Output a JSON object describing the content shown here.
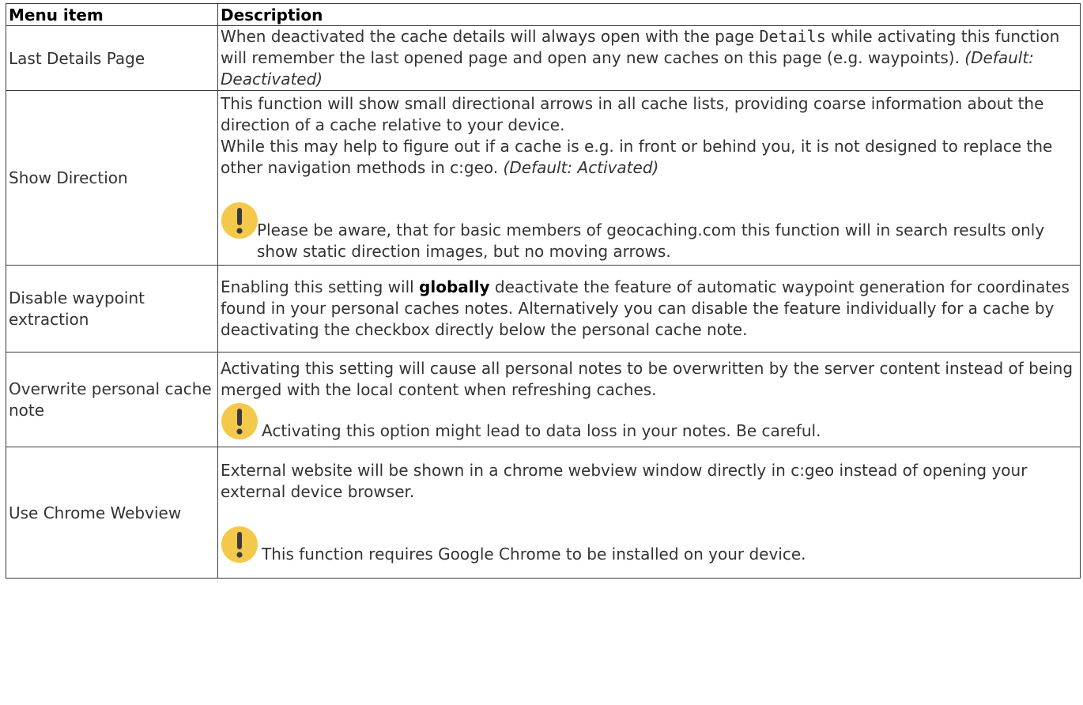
{
  "table": {
    "headers": {
      "item": "Menu item",
      "description": "Description"
    },
    "rows": [
      {
        "item": "Last Details Page",
        "text_before": "When deactivated the cache details will always open with the page ",
        "code": "Details",
        "text_after": " while activating this function will remember the last opened page and open any new caches on this page (e.g. waypoints). ",
        "default": "(Default: Deactivated)"
      },
      {
        "item": "Show Direction",
        "para1": "This function will show small directional arrows in all cache lists, providing coarse information about the direction of a cache relative to your device.",
        "para2": "While this may help to figure out if a cache is e.g. in front or behind you, it is not designed to replace the other navigation methods in c:geo. ",
        "default": "(Default: Activated)",
        "note": "Please be aware, that for basic members of geocaching.com this function will in search results only show static direction images, but no moving arrows."
      },
      {
        "item": "Disable waypoint extraction",
        "text_before": "Enabling this setting will ",
        "bold": "globally",
        "text_after": " deactivate the feature of automatic waypoint generation for coordinates found in your personal caches notes. Alternatively you can disable the feature individually for a cache by deactivating the checkbox directly below the personal cache note."
      },
      {
        "item": "Overwrite personal cache note",
        "para1": "Activating this setting will cause all personal notes to be overwritten by the server content instead of being merged with the local content when refreshing caches.",
        "note": "Activating this option might lead to data loss in your notes. Be careful."
      },
      {
        "item": "Use Chrome Webview",
        "para1": "External website will be shown in a chrome webview window directly in c:geo instead of opening your external device browser.",
        "note": "This function requires Google Chrome to be installed on your device."
      }
    ]
  },
  "icons": {
    "important": "exclamation-warning-icon",
    "important_color": "#f4c84a",
    "important_mark_color": "#3a3a3a"
  }
}
